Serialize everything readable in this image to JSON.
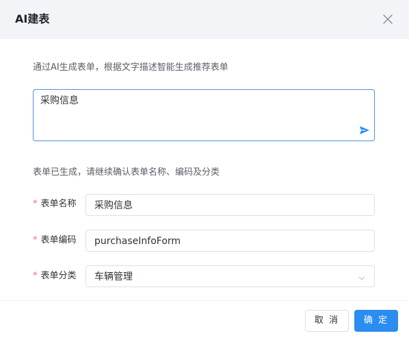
{
  "dialog": {
    "title": "AI建表",
    "close_icon": "close-icon"
  },
  "intro_text": "通过AI生成表单，根据文字描述智能生成推荐表单",
  "prompt": {
    "value": "采购信息",
    "send_icon": "send-icon"
  },
  "status_text": "表单已生成，请继续确认表单名称、编码及分类",
  "form": {
    "required_mark": "*",
    "name_label": "表单名称",
    "name_value": "采购信息",
    "code_label": "表单编码",
    "code_value": "purchaseInfoForm",
    "category_label": "表单分类",
    "category_value": "车辆管理",
    "category_icon": "chevron-down-icon"
  },
  "footer": {
    "cancel_label": "取 消",
    "ok_label": "确 定"
  },
  "colors": {
    "accent": "#2b8df0",
    "required": "#f56c6c",
    "header_bg": "#f2f4f8"
  }
}
